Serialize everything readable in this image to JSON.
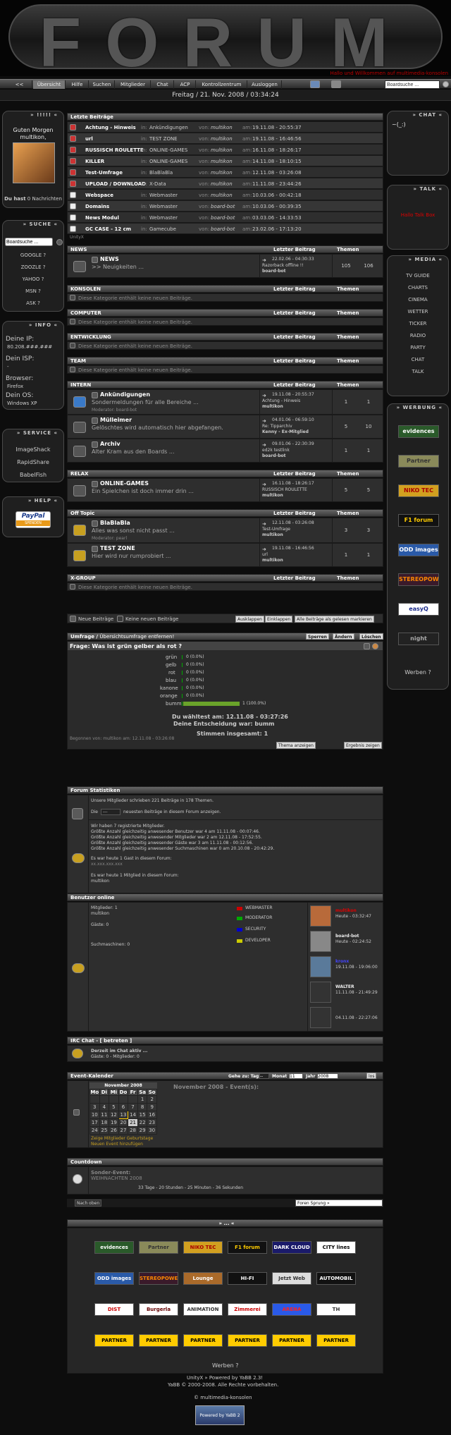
{
  "banner": {
    "title": "FORUM",
    "slogan": "Hallo und Willkommen auf multimedia-konsolen"
  },
  "nav": {
    "items": [
      "<<",
      "Übersicht",
      "Hilfe",
      "Suchen",
      "Mitglieder",
      "Chat",
      "ACP",
      "Kontrollzentrum",
      "Ausloggen"
    ],
    "search_value": "Boardsuche ..."
  },
  "date": "Freitag / 21. Nov. 2008 / 03:34:24",
  "left": {
    "welcome": {
      "header": "» !!!!! «",
      "greet1": "Guten Morgen",
      "greet2": "multikon,",
      "count": "0",
      "has_label": "Du hast",
      "msgs_label": "Nachrichten"
    },
    "suche": {
      "header": "» SUCHE «",
      "input": "Boardsuche ...",
      "links": [
        "GOOGLE ?",
        "ZOOZLE ?",
        "YAHOO ?",
        "MSN ?",
        "ASK ?"
      ]
    },
    "info": {
      "header": "» INFO «",
      "ip_label": "Deine IP:",
      "ip_value": "80.208.###.###",
      "isp_label": "Dein ISP:",
      "isp_value": "-",
      "browser_label": "Browser:",
      "browser_value": "Firefox",
      "os_label": "Dein OS:",
      "os_value": "Windows XP"
    },
    "service": {
      "header": "» SERVICE «",
      "links": [
        "ImageShack",
        "RapidShare",
        "BabelFish"
      ]
    },
    "help": {
      "header": "» HELP «",
      "paypal": "PayPal",
      "paypal_sub": "SPENDEN"
    }
  },
  "right": {
    "chat": {
      "header": "» CHAT «",
      "text": "~(_:)"
    },
    "talk": {
      "header": "» TALK «",
      "text": "Hallo Talk Box"
    },
    "media": {
      "header": "» MEDIA «",
      "links": [
        "TV GUIDE",
        "CHARTS",
        "CINEMA",
        "WETTER",
        "TICKER",
        "RADIO",
        "PARTY",
        "CHAT",
        "TALK"
      ]
    },
    "werbung": {
      "header": "» WERBUNG «",
      "logos": [
        "evidences",
        "Partner",
        "NIKO TEC",
        "F1 forum",
        "ODD images",
        "STEREOPOWER",
        "easyQ",
        "night"
      ],
      "werben": "Werben ?"
    }
  },
  "latest": {
    "header": "Letzte Beiträge",
    "items": [
      {
        "title": "Achtung - Hinweis",
        "forum": "Ankündigungen",
        "user": "multikon",
        "date": "19.11.08 - 20:55:37"
      },
      {
        "title": "url",
        "forum": "TEST ZONE",
        "user": "multikon",
        "date": "19.11.08 - 16:46:56"
      },
      {
        "title": "RUSSISCH ROULETTE",
        "forum": "ONLINE-GAMES",
        "user": "multikon",
        "date": "16.11.08 - 18:26:17"
      },
      {
        "title": "KILLER",
        "forum": "ONLINE-GAMES",
        "user": "multikon",
        "date": "14.11.08 - 18:10:15"
      },
      {
        "title": "Test-Umfrage",
        "forum": "BlaBlaBla",
        "user": "multikon",
        "date": "12.11.08 - 03:26:08"
      },
      {
        "title": "UPLOAD / DOWNLOAD",
        "forum": "X-Data",
        "user": "multikon",
        "date": "11.11.08 - 23:44:26"
      },
      {
        "title": "Webspace",
        "forum": "Webmaster",
        "user": "multikon",
        "date": "10.03.06 - 00:42:18"
      },
      {
        "title": "Domains",
        "forum": "Webmaster",
        "user": "board-bot",
        "date": "10.03.06 - 00:39:35"
      },
      {
        "title": "News Modul",
        "forum": "Webmaster",
        "user": "board-bot",
        "date": "03.03.06 - 14:33:53"
      },
      {
        "title": "GC CASE - 12 cm",
        "forum": "Gamecube",
        "user": "board-bot",
        "date": "23.02.06 - 17:13:20"
      }
    ],
    "labels": {
      "in": "in:",
      "from": "von:",
      "on": "am:"
    },
    "unity": "UnityX"
  },
  "col": {
    "last": "Letzter Beitrag",
    "topics": "Themen Beiträge"
  },
  "empty_text": "Diese Kategorie enthält keine neuen Beiträge.",
  "categories": [
    {
      "name": "NEWS",
      "boards": [
        {
          "title": "NEWS",
          "desc": ">> Neuigkeiten ...",
          "mod": "",
          "last_date": "22.02.06 - 04:30:33",
          "last_in": "Razorback offline !!",
          "last_by": "board-bot",
          "topics": "105",
          "posts": "106"
        }
      ]
    },
    {
      "name": "KONSOLEN",
      "boards": []
    },
    {
      "name": "COMPUTER",
      "boards": []
    },
    {
      "name": "ENTWICKLUNG",
      "boards": []
    },
    {
      "name": "TEAM",
      "boards": []
    },
    {
      "name": "INTERN",
      "boards": [
        {
          "title": "Ankündigungen",
          "desc": "Sondermeldungen für alle Bereiche ...",
          "mod": "Moderator: board-bot",
          "last_date": "19.11.08 - 20:55:37",
          "last_in": "Achtung - Hinweis",
          "last_by": "multikon",
          "topics": "1",
          "posts": "1"
        },
        {
          "title": "Mülleimer",
          "desc": "Gelöschtes wird automatisch hier abgefangen.",
          "mod": "",
          "last_date": "04.01.06 - 06:59:10",
          "last_in": "Re: Tipparchiv",
          "last_by": "Kenny - Ex-Mitglied",
          "topics": "5",
          "posts": "10"
        },
        {
          "title": "Archiv",
          "desc": "Alter Kram aus den Boards ...",
          "mod": "",
          "last_date": "09.01.06 - 22:30:39",
          "last_in": "ed2k testlink",
          "last_by": "board-bot",
          "topics": "1",
          "posts": "1"
        }
      ]
    },
    {
      "name": "RELAX",
      "boards": [
        {
          "title": "ONLINE-GAMES",
          "desc": "Ein Spielchen ist doch immer drin ...",
          "mod": "",
          "last_date": "16.11.08 - 18:26:17",
          "last_in": "RUSSISCH ROULETTE",
          "last_by": "multikon",
          "topics": "5",
          "posts": "5"
        }
      ]
    },
    {
      "name": "Off Topic",
      "boards": [
        {
          "title": "BlaBlaBla",
          "desc": "Alles was sonst nicht passt ...",
          "mod": "Moderator: pearl",
          "last_date": "12.11.08 - 03:26:08",
          "last_in": "Test-Umfrage",
          "last_by": "multikon",
          "topics": "3",
          "posts": "3"
        },
        {
          "title": "TEST ZONE",
          "desc": "Hier wird nur rumprobiert ...",
          "mod": "",
          "last_date": "19.11.08 - 16:46:56",
          "last_in": "url",
          "last_by": "multikon",
          "topics": "1",
          "posts": "1"
        }
      ]
    },
    {
      "name": "X-GROUP",
      "boards": []
    }
  ],
  "legend": {
    "new": "Neue Beiträge",
    "none": "Keine neuen Beiträge",
    "b1": "Ausklappen",
    "b2": "Einklappen",
    "b3": "Alle Beiträge als gelesen markieren"
  },
  "poll": {
    "header": "Umfrage",
    "remove": "Übersichtsumfrage entfernen!",
    "b1": "Sperren",
    "b2": "Ändern",
    "b3": "Löschen",
    "question": "Frage: Was ist grün gelber als rot ?",
    "options": [
      {
        "label": "grün",
        "votes": "0 (0.0%)",
        "pct": 0
      },
      {
        "label": "gelb",
        "votes": "0 (0.0%)",
        "pct": 0
      },
      {
        "label": "rot",
        "votes": "0 (0.0%)",
        "pct": 0
      },
      {
        "label": "blau",
        "votes": "0 (0.0%)",
        "pct": 0
      },
      {
        "label": "kanone",
        "votes": "0 (0.0%)",
        "pct": 0
      },
      {
        "label": "orange",
        "votes": "0 (0.0%)",
        "pct": 0
      },
      {
        "label": "bumm",
        "votes": "1 (100.0%)",
        "pct": 100
      }
    ],
    "voted": "Du wähltest am: 12.11.08 - 03:27:26",
    "choice": "Deine Entscheidung war: bumm",
    "total": "Stimmen insgesamt: 1",
    "started": "Begonnen von: multikon am: 12.11.08 - 03:26:08",
    "show_topic": "Thema anzeigen",
    "show_result": "Ergebnis zeigen"
  },
  "stats": {
    "header": "Forum Statistiken",
    "l1": "Unsere Mitglieder schrieben 221 Beiträge in 178 Themen.",
    "l2a": "Die",
    "l2sel": "---",
    "l2b": "neuesten Beiträge in diesem Forum anzeigen.",
    "r1": "Wir haben 7 registrierte Mitglieder.",
    "r2": "Größte Anzahl gleichzeitig anwesender Benutzer war 4 am 11.11.08 - 00:07:46.",
    "r3": "Größte Anzahl gleichzeitig anwesender Mitglieder war 2 am 12.11.08 - 17:52:55.",
    "r4": "Größte Anzahl gleichzeitig anwesender Gäste war 3 am 11.11.08 - 00:12:56.",
    "r5": "Größte Anzahl gleichzeitig anwesender Suchmaschinen war 0 am 20.10.08 - 20:42:29.",
    "g1": "Es war heute 1 Gast in diesem Forum:",
    "g1v": "xx.xxx.xxx.xxx",
    "g2": "Es war heute 1 Mitglied in diesem Forum:",
    "g2v": "multikon"
  },
  "online": {
    "header": "Benutzer online",
    "members": "Mitglieder: 1",
    "member_name": "multikon",
    "guests": "Gäste: 0",
    "bots": "Suchmaschinen: 0",
    "legend": [
      "WEBMASTER",
      "MODERATOR",
      "SECURITY",
      "DEVELOPER"
    ],
    "users": [
      {
        "name": "multikon",
        "time": "Heute - 03:32:47"
      },
      {
        "name": "board-bot",
        "time": "Heute - 02:24:52"
      },
      {
        "name": "kronx",
        "time": "19.11.08 - 19:06:00"
      },
      {
        "name": "WALTER",
        "time": "11.11.08 - 21:49:29"
      },
      {
        "name": "",
        "time": "04.11.08 - 22:27:06"
      }
    ]
  },
  "irc": {
    "header": "IRC Chat - [ betreten ]",
    "l1": "Derzeit im Chat aktiv ...",
    "l2": "Gäste: 0 - Mitglieder: 0"
  },
  "calendar": {
    "header": "Event-Kalender",
    "goto": "Gehe zu: Tag",
    "day": "--",
    "month_lbl": "Monat",
    "month": "11",
    "year_lbl": "Jahr",
    "year": "2008",
    "go": "los",
    "title": "November 2008",
    "events": "November 2008 - Event(s):",
    "days": [
      "Mo",
      "Di",
      "Mi",
      "Do",
      "Fr",
      "Sa",
      "So"
    ],
    "weeks": [
      [
        "",
        "",
        "",
        "",
        "",
        "1",
        "2"
      ],
      [
        "3",
        "4",
        "5",
        "6",
        "7",
        "8",
        "9"
      ],
      [
        "10",
        "11",
        "12",
        "13",
        "14",
        "15",
        "16"
      ],
      [
        "17",
        "18",
        "19",
        "20",
        "21",
        "22",
        "23"
      ],
      [
        "24",
        "25",
        "26",
        "27",
        "28",
        "29",
        "30"
      ]
    ],
    "opt1": "Zeige Mitglieder Geburtstage",
    "opt2": "Neuen Event hinzufügen"
  },
  "countdown": {
    "header": "Countdown",
    "title": "Sonder-Event:",
    "event": "WEIHNACHTEN 2008",
    "timer": "33 Tage - 20 Stunden - 25 Minuten - 36 Sekunden"
  },
  "bottom": {
    "nach_oben": "Nach oben",
    "jump": "Foren Sprung »"
  },
  "partners": {
    "header": "» ... «",
    "logos": [
      "evidences",
      "Partner",
      "NIKO TEC",
      "F1 forum",
      "DARK CLOUD",
      "CITY lines",
      "ODD images",
      "STEREOPOWER",
      "Lounge",
      "HI-FI",
      "Jetzt Web",
      "AUTOMOBIL",
      "DIST",
      "Burgerla Shop",
      "ANIMATION",
      "Zimmerei",
      "ARENA",
      "TH",
      "PARTNER",
      "PARTNER",
      "PARTNER",
      "PARTNER",
      "PARTNER",
      "PARTNER"
    ],
    "werben": "Werben ?"
  },
  "footer": {
    "l1": "UnityX » Powered by YaBB 2.3!",
    "l2": "YaBB © 2000-2008. Alle Rechte vorbehalten.",
    "l3": "© multimedia-konsolen",
    "powered": "Powered by YaBB 2"
  }
}
